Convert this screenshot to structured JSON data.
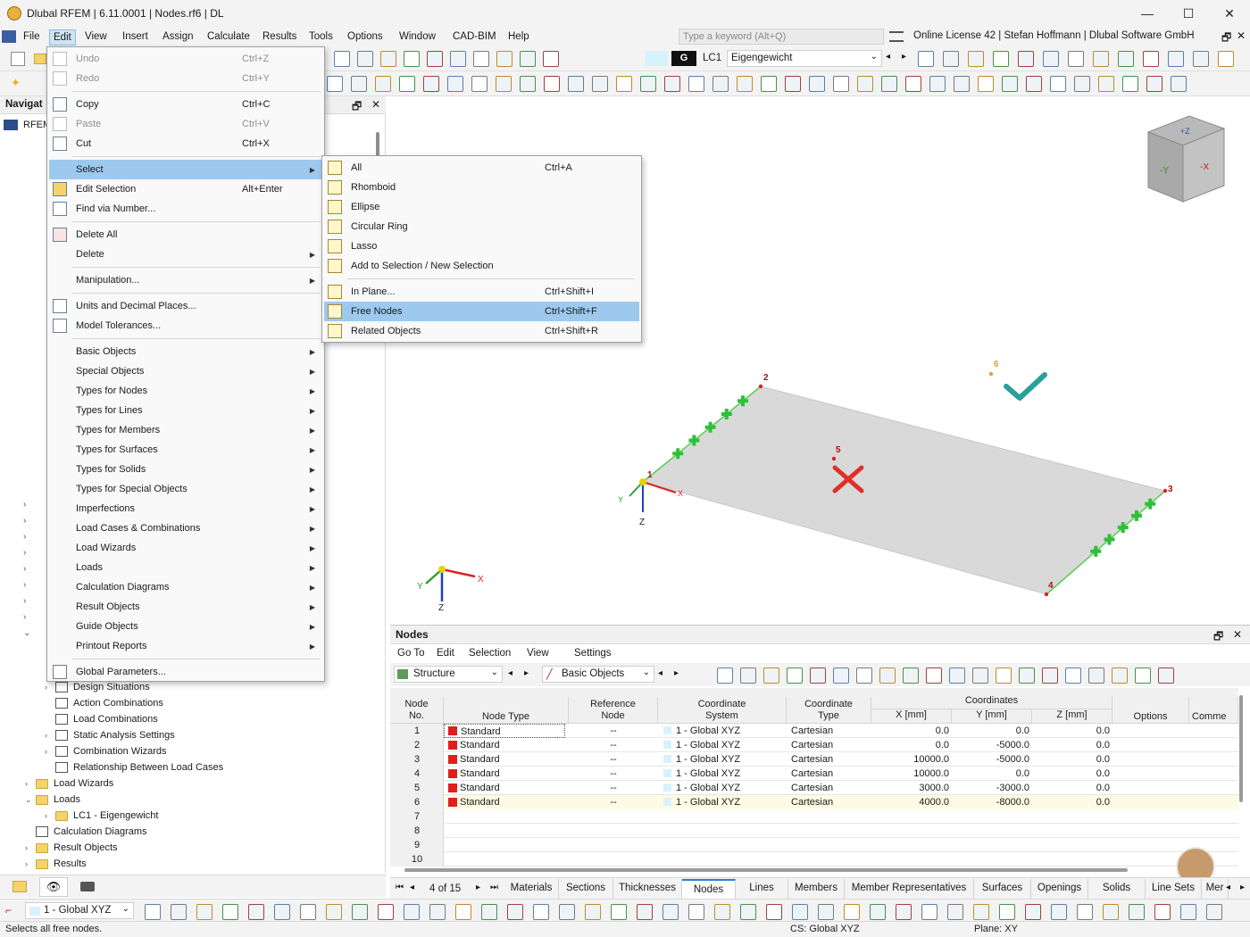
{
  "window": {
    "title": "Dlubal RFEM | 6.11.0001 | Nodes.rf6 | DL",
    "minimize": "—",
    "maximize": "☐",
    "close": "✕"
  },
  "menubar": {
    "items": [
      "File",
      "Edit",
      "View",
      "Insert",
      "Assign",
      "Calculate",
      "Results",
      "Tools",
      "Options",
      "Window",
      "CAD-BIM",
      "Help"
    ],
    "active": "Edit",
    "search_placeholder": "Type a keyword (Alt+Q)",
    "license": "Online License 42 | Stefan Hoffmann | Dlubal Software GmbH"
  },
  "toolbar": {
    "load_case_color": "G",
    "load_case_id": "LC1",
    "load_case_name": "Eigengewicht"
  },
  "navigator": {
    "header": "Navigat",
    "root": "RFEM",
    "items": [
      {
        "label": "Design Situations",
        "indent": 2,
        "chev": "›"
      },
      {
        "label": "Action Combinations",
        "indent": 2,
        "chev": ""
      },
      {
        "label": "Load Combinations",
        "indent": 2,
        "chev": ""
      },
      {
        "label": "Static Analysis Settings",
        "indent": 2,
        "chev": "›"
      },
      {
        "label": "Combination Wizards",
        "indent": 2,
        "chev": "›"
      },
      {
        "label": "Relationship Between Load Cases",
        "indent": 2,
        "chev": ""
      },
      {
        "label": "Load Wizards",
        "indent": 1,
        "chev": "›"
      },
      {
        "label": "Loads",
        "indent": 1,
        "chev": "⌄"
      },
      {
        "label": "LC1 - Eigengewicht",
        "indent": 2,
        "chev": "›"
      },
      {
        "label": "Calculation Diagrams",
        "indent": 1,
        "chev": ""
      },
      {
        "label": "Result Objects",
        "indent": 1,
        "chev": "›"
      },
      {
        "label": "Results",
        "indent": 1,
        "chev": "›"
      }
    ]
  },
  "edit_menu": {
    "items": [
      {
        "label": "Undo",
        "shortcut": "Ctrl+Z",
        "disabled": true
      },
      {
        "label": "Redo",
        "shortcut": "Ctrl+Y",
        "disabled": true
      },
      {
        "label": "Copy",
        "shortcut": "Ctrl+C"
      },
      {
        "label": "Paste",
        "shortcut": "Ctrl+V",
        "disabled": true
      },
      {
        "label": "Cut",
        "shortcut": "Ctrl+X"
      },
      {
        "label": "Select",
        "submenu": true,
        "highlight": true
      },
      {
        "label": "Edit Selection",
        "shortcut": "Alt+Enter"
      },
      {
        "label": "Find via Number..."
      },
      {
        "label": "Delete All"
      },
      {
        "label": "Delete",
        "submenu": true
      },
      {
        "label": "Manipulation...",
        "submenu": true
      },
      {
        "label": "Units and Decimal Places..."
      },
      {
        "label": "Model Tolerances..."
      },
      {
        "label": "Basic Objects",
        "submenu": true
      },
      {
        "label": "Special Objects",
        "submenu": true
      },
      {
        "label": "Types for Nodes",
        "submenu": true
      },
      {
        "label": "Types for Lines",
        "submenu": true
      },
      {
        "label": "Types for Members",
        "submenu": true
      },
      {
        "label": "Types for Surfaces",
        "submenu": true
      },
      {
        "label": "Types for Solids",
        "submenu": true
      },
      {
        "label": "Types for Special Objects",
        "submenu": true
      },
      {
        "label": "Imperfections",
        "submenu": true
      },
      {
        "label": "Load Cases & Combinations",
        "submenu": true
      },
      {
        "label": "Load Wizards",
        "submenu": true
      },
      {
        "label": "Loads",
        "submenu": true
      },
      {
        "label": "Calculation Diagrams",
        "submenu": true
      },
      {
        "label": "Result Objects",
        "submenu": true
      },
      {
        "label": "Guide Objects",
        "submenu": true
      },
      {
        "label": "Printout Reports",
        "submenu": true
      },
      {
        "label": "Global Parameters..."
      }
    ]
  },
  "select_submenu": {
    "items": [
      {
        "label": "All",
        "shortcut": "Ctrl+A"
      },
      {
        "label": "Rhomboid"
      },
      {
        "label": "Ellipse"
      },
      {
        "label": "Circular Ring"
      },
      {
        "label": "Lasso"
      },
      {
        "label": "Add to Selection / New Selection"
      },
      {
        "label": "In Plane...",
        "shortcut": "Ctrl+Shift+I"
      },
      {
        "label": "Free Nodes",
        "shortcut": "Ctrl+Shift+F",
        "highlight": true
      },
      {
        "label": "Related Objects",
        "shortcut": "Ctrl+Shift+R"
      }
    ]
  },
  "viewport": {
    "node_labels": [
      "1",
      "2",
      "3",
      "4",
      "5",
      "6"
    ],
    "axis_x": "X",
    "axis_y": "Y",
    "axis_z": "Z",
    "cube_labels": [
      "+Z",
      "-Y",
      "-X"
    ]
  },
  "nodes_panel": {
    "title": "Nodes",
    "menu": [
      "Go To",
      "Edit",
      "Selection",
      "View",
      "Settings"
    ],
    "structure_select": "Structure",
    "objects_select": "Basic Objects",
    "columns": {
      "node_no": "Node\nNo.",
      "node_type": "Node Type",
      "reference_node": "Reference\nNode",
      "coordinate_system": "Coordinate\nSystem",
      "coordinate_type": "Coordinate\nType",
      "coordinates": "Coordinates",
      "x": "X [mm]",
      "y": "Y [mm]",
      "z": "Z [mm]",
      "options": "Options",
      "comment": "Comme"
    },
    "rows": [
      {
        "no": "1",
        "type": "Standard",
        "ref": "--",
        "cs": "1 - Global XYZ",
        "ct": "Cartesian",
        "x": "0.0",
        "y": "0.0",
        "z": "0.0"
      },
      {
        "no": "2",
        "type": "Standard",
        "ref": "--",
        "cs": "1 - Global XYZ",
        "ct": "Cartesian",
        "x": "0.0",
        "y": "-5000.0",
        "z": "0.0"
      },
      {
        "no": "3",
        "type": "Standard",
        "ref": "--",
        "cs": "1 - Global XYZ",
        "ct": "Cartesian",
        "x": "10000.0",
        "y": "-5000.0",
        "z": "0.0"
      },
      {
        "no": "4",
        "type": "Standard",
        "ref": "--",
        "cs": "1 - Global XYZ",
        "ct": "Cartesian",
        "x": "10000.0",
        "y": "0.0",
        "z": "0.0"
      },
      {
        "no": "5",
        "type": "Standard",
        "ref": "--",
        "cs": "1 - Global XYZ",
        "ct": "Cartesian",
        "x": "3000.0",
        "y": "-3000.0",
        "z": "0.0"
      },
      {
        "no": "6",
        "type": "Standard",
        "ref": "--",
        "cs": "1 - Global XYZ",
        "ct": "Cartesian",
        "x": "4000.0",
        "y": "-8000.0",
        "z": "0.0"
      }
    ],
    "empty_rows": [
      "7",
      "8",
      "9",
      "10"
    ],
    "pager": "4 of 15",
    "tabs": [
      "Materials",
      "Sections",
      "Thicknesses",
      "Nodes",
      "Lines",
      "Members",
      "Member Representatives",
      "Surfaces",
      "Openings",
      "Solids",
      "Line Sets",
      "Mer"
    ],
    "active_tab": "Nodes"
  },
  "bottom_toolbar": {
    "coordinate_system": "1 - Global XYZ"
  },
  "statusbar": {
    "message": "Selects all free nodes.",
    "cs": "CS: Global XYZ",
    "plane": "Plane: XY"
  },
  "colors": {
    "accent": "#2a7fd0",
    "highlight": "#9dc9ef",
    "surface": "#d9d9d9",
    "support": "#2fbf3a",
    "node": "#e31c1c",
    "check": "#2aa198",
    "cross": "#e0302a"
  }
}
